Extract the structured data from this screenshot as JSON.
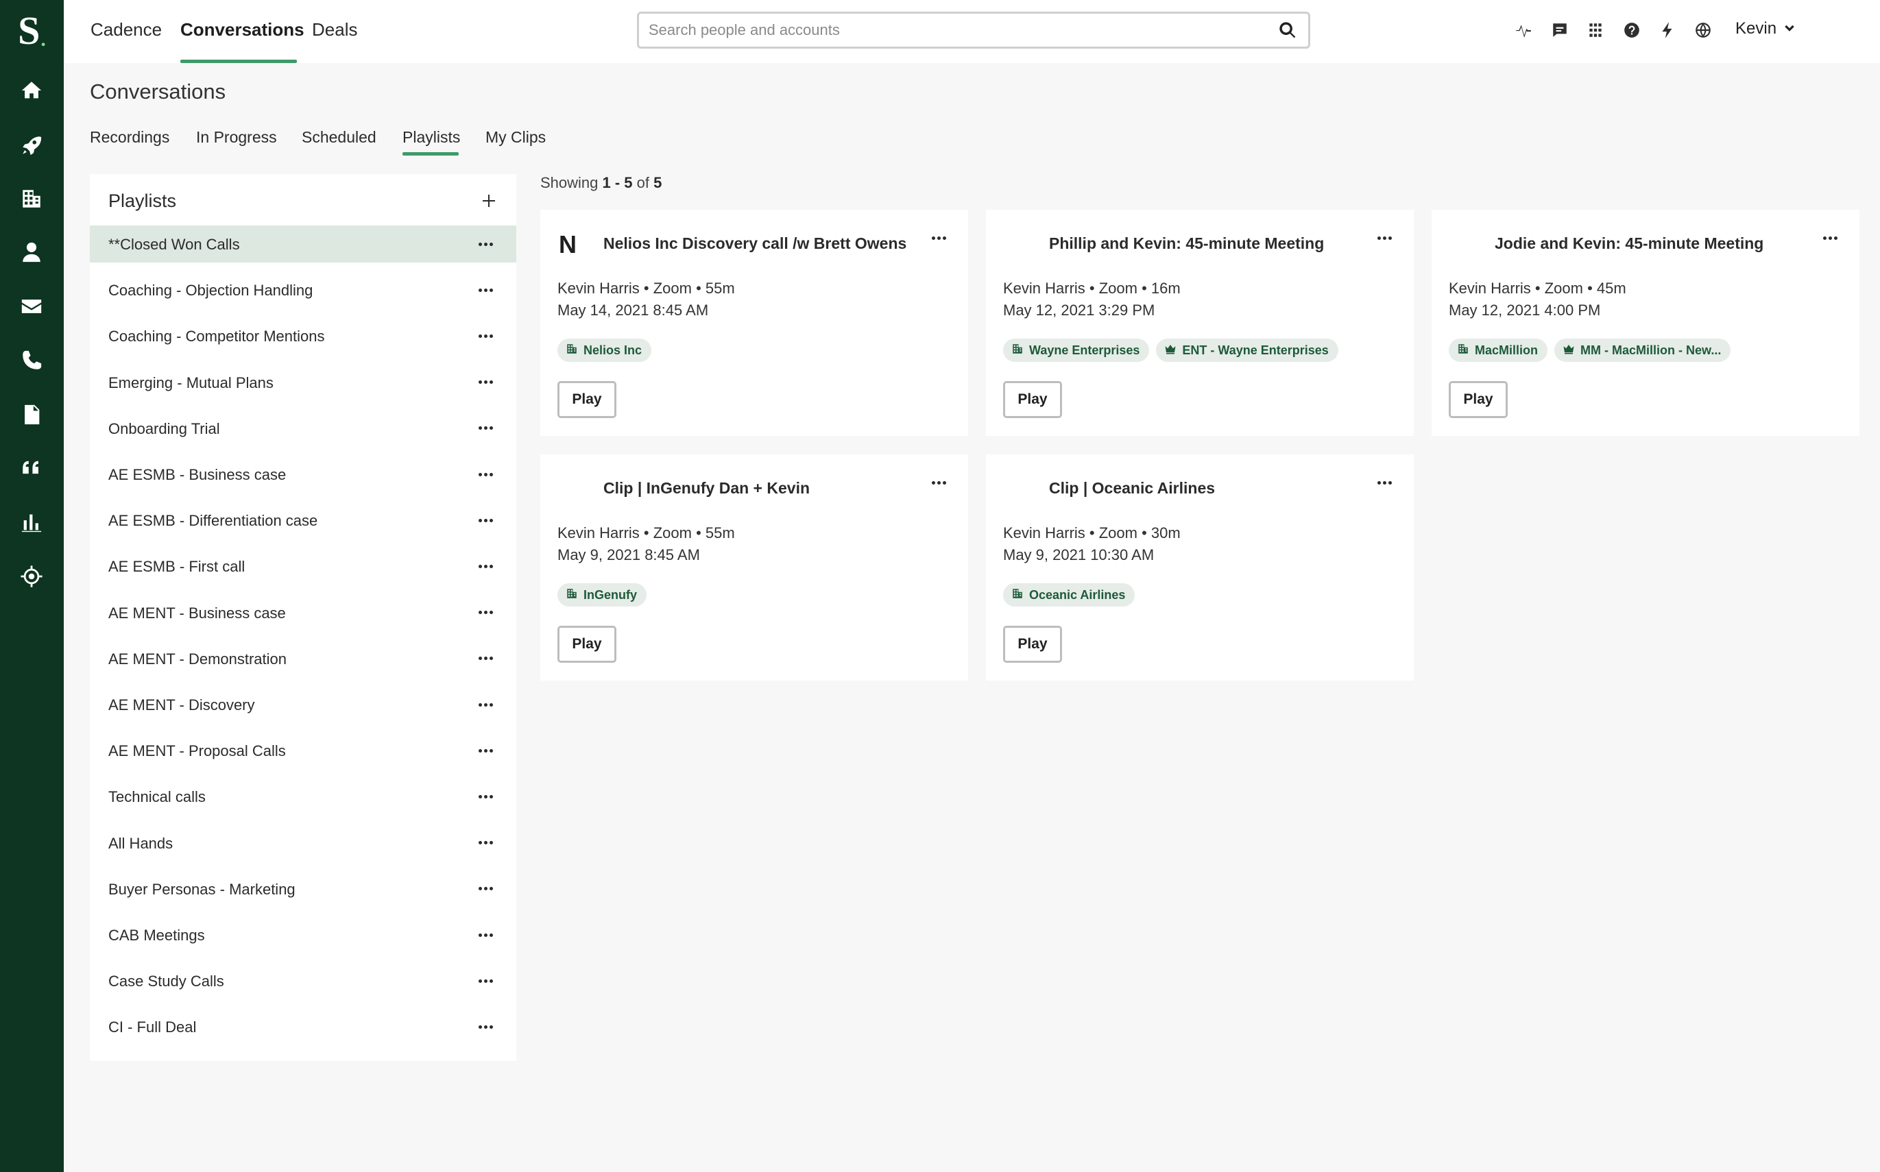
{
  "app": {
    "logo_letter": "S",
    "logo_dot": ".",
    "rail_icons": [
      "home-icon",
      "rocket-icon",
      "building-icon",
      "person-icon",
      "envelope-icon",
      "phone-icon",
      "document-icon",
      "quote-icon",
      "bar-chart-icon",
      "crosshair-icon"
    ]
  },
  "topnav": {
    "items": [
      "Cadence",
      "Conversations",
      "Deals"
    ],
    "active": "Conversations"
  },
  "search": {
    "placeholder": "Search people and accounts",
    "value": ""
  },
  "toolbar_icons": [
    "activity-icon",
    "chat-icon",
    "apps-grid-icon",
    "help-icon",
    "lightning-icon",
    "globe-icon"
  ],
  "user": {
    "name": "Kevin"
  },
  "page": {
    "title": "Conversations",
    "subtabs": [
      "Recordings",
      "In Progress",
      "Scheduled",
      "Playlists",
      "My Clips"
    ],
    "active_subtab": "Playlists"
  },
  "playlists": {
    "header": "Playlists",
    "selected": "**Closed Won Calls",
    "items": [
      "**Closed Won Calls",
      "Coaching - Objection Handling",
      "Coaching - Competitor Mentions",
      "Emerging - Mutual Plans",
      "Onboarding Trial",
      "AE ESMB - Business case",
      "AE ESMB - Differentiation case",
      "AE ESMB - First call",
      "AE MENT - Business case",
      "AE MENT - Demonstration",
      "AE MENT - Discovery",
      "AE MENT - Proposal Calls",
      "Technical calls",
      "All Hands",
      "Buyer Personas - Marketing",
      "CAB Meetings",
      "Case Study Calls",
      "CI - Full Deal"
    ]
  },
  "results": {
    "showing_prefix": "Showing ",
    "range": "1 - 5",
    "of_word": " of ",
    "total": "5"
  },
  "cards": [
    {
      "avatar": "N",
      "title": "Nelios Inc Discovery call /w Brett Owens",
      "meta": "Kevin Harris • Zoom • 55m",
      "date": "May 14, 2021 8:45 AM",
      "tags": [
        {
          "label": "Nelios Inc",
          "icon": "building-icon"
        }
      ],
      "play_label": "Play"
    },
    {
      "avatar": "",
      "title": "Phillip and Kevin: 45-minute Meeting",
      "meta": "Kevin Harris • Zoom • 16m",
      "date": "May 12, 2021 3:29 PM",
      "tags": [
        {
          "label": "Wayne Enterprises",
          "icon": "building-icon"
        },
        {
          "label": "ENT - Wayne Enterprises",
          "icon": "crown-icon"
        }
      ],
      "play_label": "Play"
    },
    {
      "avatar": "",
      "title": "Jodie and Kevin: 45-minute Meeting",
      "meta": "Kevin Harris • Zoom • 45m",
      "date": "May 12, 2021 4:00 PM",
      "tags": [
        {
          "label": "MacMillion",
          "icon": "building-icon"
        },
        {
          "label": "MM - MacMillion - New...",
          "icon": "crown-icon"
        }
      ],
      "play_label": "Play"
    },
    {
      "avatar": "",
      "title": "Clip | InGenufy Dan + Kevin",
      "meta": "Kevin Harris • Zoom • 55m",
      "date": "May 9, 2021 8:45 AM",
      "tags": [
        {
          "label": "InGenufy",
          "icon": "building-icon"
        }
      ],
      "play_label": "Play"
    },
    {
      "avatar": "",
      "title": "Clip | Oceanic Airlines",
      "meta": "Kevin Harris • Zoom • 30m",
      "date": "May 9, 2021 10:30 AM",
      "tags": [
        {
          "label": "Oceanic Airlines",
          "icon": "building-icon"
        }
      ],
      "play_label": "Play"
    }
  ],
  "colors": {
    "rail_bg": "#0d3521",
    "accent": "#3f9a69",
    "selected_row": "#dde8e0",
    "tag_bg": "#e6ece8",
    "tag_text": "#1d5a39"
  }
}
